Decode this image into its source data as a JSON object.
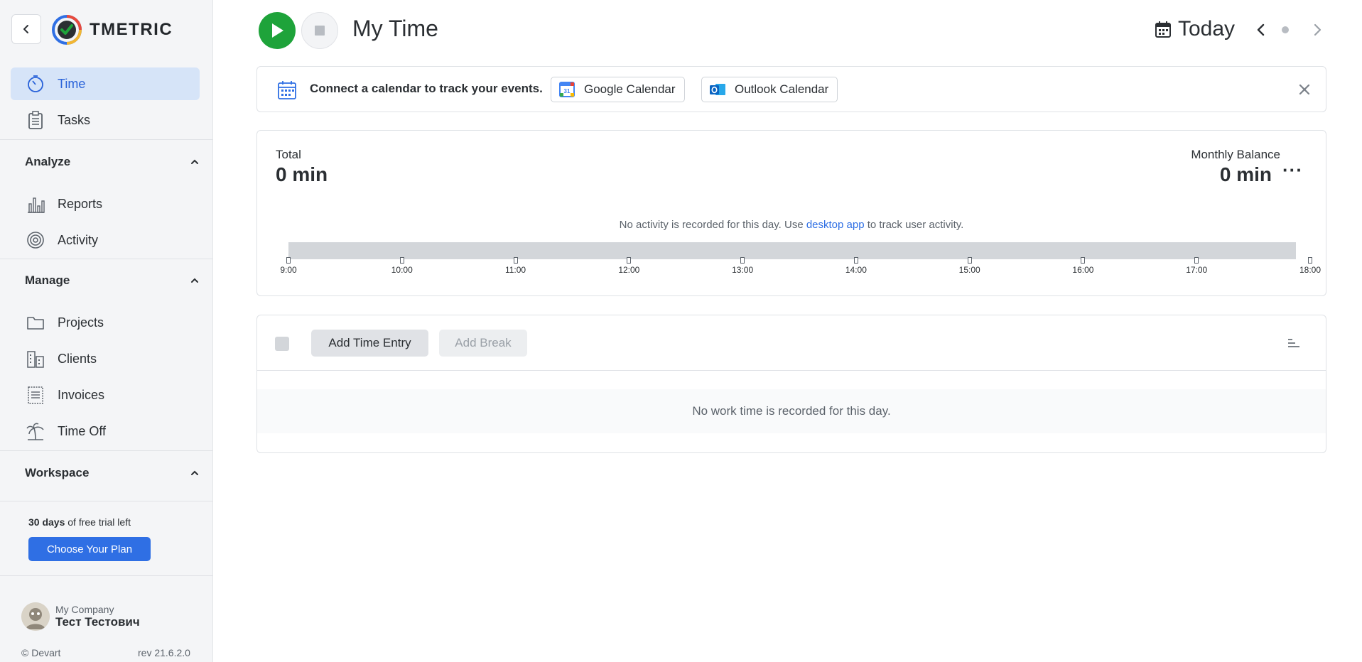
{
  "app": {
    "name": "TMETRIC"
  },
  "sidebar": {
    "collapse_icon": "chevron-left-icon",
    "items_top": [
      {
        "label": "Time",
        "icon": "stopwatch-icon",
        "active": true
      },
      {
        "label": "Tasks",
        "icon": "clipboard-icon",
        "active": false
      }
    ],
    "sections": [
      {
        "title": "Analyze",
        "items": [
          {
            "label": "Reports",
            "icon": "bar-chart-icon"
          },
          {
            "label": "Activity",
            "icon": "activity-rings-icon"
          }
        ]
      },
      {
        "title": "Manage",
        "items": [
          {
            "label": "Projects",
            "icon": "folder-icon"
          },
          {
            "label": "Clients",
            "icon": "buildings-icon"
          },
          {
            "label": "Invoices",
            "icon": "invoice-icon"
          },
          {
            "label": "Time Off",
            "icon": "palm-tree-icon"
          }
        ]
      },
      {
        "title": "Workspace",
        "items": []
      }
    ],
    "trial": {
      "days": "30 days",
      "suffix": "of free trial left"
    },
    "plan_button": "Choose Your Plan",
    "user": {
      "company": "My Company",
      "name": "Тест Тестович"
    },
    "footer": {
      "copyright": "© Devart",
      "revision": "rev 21.6.2.0"
    }
  },
  "header": {
    "title": "My Time",
    "date_label": "Today",
    "prev_icon": "chevron-left-icon",
    "next_icon": "chevron-right-icon"
  },
  "calendar_banner": {
    "text": "Connect a calendar to track your events.",
    "google_label": "Google Calendar",
    "outlook_label": "Outlook Calendar"
  },
  "summary": {
    "total_label": "Total",
    "total_value": "0 min",
    "balance_label": "Monthly Balance",
    "balance_value": "0 min",
    "more_label": "···",
    "note_prefix": "No activity is recorded for this day. Use ",
    "note_link": "desktop app",
    "note_suffix": " to track user activity.",
    "ticks": [
      "9:00",
      "10:00",
      "11:00",
      "12:00",
      "13:00",
      "14:00",
      "15:00",
      "16:00",
      "17:00",
      "18:00"
    ]
  },
  "entries": {
    "add_entry_label": "Add Time Entry",
    "add_break_label": "Add Break",
    "empty_text": "No work time is recorded for this day."
  },
  "colors": {
    "accent": "#2f6fe4",
    "active_nav_bg": "#d6e4f8",
    "play_green": "#1ea33a"
  }
}
